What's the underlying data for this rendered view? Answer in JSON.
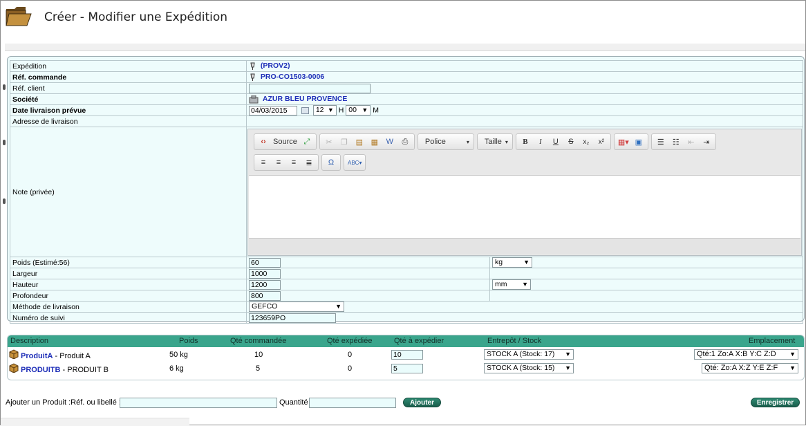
{
  "header": {
    "title": "Créer - Modifier une Expédition",
    "icon": "folder-icon"
  },
  "form": {
    "expedition": {
      "label": "Expédition",
      "value": "(PROV2)"
    },
    "ref_commande": {
      "label": "Réf. commande",
      "value": "PRO-CO1503-0006"
    },
    "ref_client": {
      "label": "Réf. client",
      "value": ""
    },
    "societe": {
      "label": "Société",
      "value": "AZUR BLEU PROVENCE"
    },
    "date_livraison": {
      "label": "Date livraison prévue",
      "date": "04/03/2015",
      "hour": "12",
      "h_label": "H",
      "minute": "00",
      "m_label": "M"
    },
    "adresse": {
      "label": "Adresse de livraison"
    },
    "note": {
      "label": "Note (privée)"
    },
    "poids": {
      "label": "Poids  (Estimé:56)",
      "value": "60",
      "unit": "kg"
    },
    "largeur": {
      "label": "Largeur",
      "value": "1000"
    },
    "hauteur": {
      "label": "Hauteur",
      "value": "1200",
      "unit": "mm"
    },
    "profondeur": {
      "label": "Profondeur",
      "value": "800"
    },
    "methode": {
      "label": "Méthode de livraison",
      "value": "GEFCO"
    },
    "suivi": {
      "label": "Numéro de suivi",
      "value": "123659PO"
    }
  },
  "editor": {
    "source_label": "Source",
    "police_label": "Police",
    "taille_label": "Taille",
    "bold": "B",
    "italic": "I",
    "underline": "U",
    "strike": "S",
    "sub": "x₂",
    "sup": "x²",
    "omega": "Ω",
    "spell": "ABC"
  },
  "products": {
    "headers": {
      "description": "Description",
      "poids": "Poids",
      "qte_commandee": "Qté commandée",
      "qte_expediee": "Qté expédiée",
      "qte_a_expedier": "Qté à expédier",
      "entrepot": "Entrepôt / Stock",
      "emplacement": "Emplacement"
    },
    "rows": [
      {
        "ref": "ProduitA",
        "label": " - Produit A",
        "poids": "50 kg",
        "qte_commandee": "10",
        "qte_expediee": "0",
        "qte_a_expedier": "10",
        "entrepot": "STOCK A (Stock: 17)",
        "emplacement": "Qté:1 Zo:A X:B Y:C Z:D"
      },
      {
        "ref": "PRODUITB",
        "label": " - PRODUIT B",
        "poids": "6 kg",
        "qte_commandee": "5",
        "qte_expediee": "0",
        "qte_a_expedier": "5",
        "entrepot": "STOCK A (Stock: 15)",
        "emplacement": "Qté: Zo:A X:Z Y:E Z:F"
      }
    ]
  },
  "add_product": {
    "label": "Ajouter un Produit :Réf. ou libellé :",
    "qty_label": "Quantité",
    "add_button": "Ajouter",
    "save_button": "Enregistrer"
  }
}
